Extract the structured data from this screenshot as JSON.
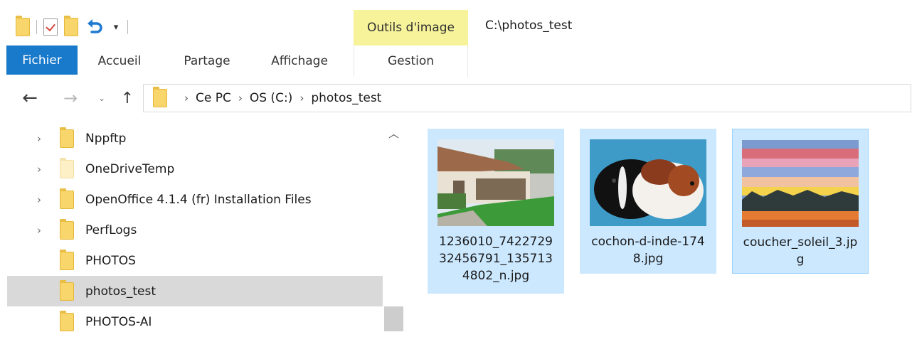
{
  "title_bar": {
    "contextual_tab": "Outils d'image",
    "window_title": "C:\\photos_test"
  },
  "ribbon_tabs": {
    "file": "Fichier",
    "home": "Accueil",
    "share": "Partage",
    "view": "Affichage",
    "manage": "Gestion"
  },
  "address_bar": {
    "crumbs": [
      "Ce PC",
      "OS (C:)",
      "photos_test"
    ]
  },
  "nav_tree": [
    {
      "label": "Nppftp",
      "expandable": true,
      "selected": false
    },
    {
      "label": "OneDriveTemp",
      "expandable": true,
      "selected": false
    },
    {
      "label": "OpenOffice 4.1.4 (fr) Installation Files",
      "expandable": true,
      "selected": false
    },
    {
      "label": "PerfLogs",
      "expandable": true,
      "selected": false
    },
    {
      "label": "PHOTOS",
      "expandable": false,
      "selected": false
    },
    {
      "label": "photos_test",
      "expandable": false,
      "selected": true
    },
    {
      "label": "PHOTOS-AI",
      "expandable": false,
      "selected": false
    }
  ],
  "files": [
    {
      "name": "1236010_742272932456791_1357134802_n.jpg",
      "selected": true
    },
    {
      "name": "cochon-d-inde-1748.jpg",
      "selected": true
    },
    {
      "name": "coucher_soleil_3.jpg",
      "selected": true
    }
  ],
  "colors": {
    "file_tab": "#1979ca",
    "contextual_tab": "#f6f39b",
    "selection": "#cce8ff",
    "folder": "#f8d66c"
  }
}
